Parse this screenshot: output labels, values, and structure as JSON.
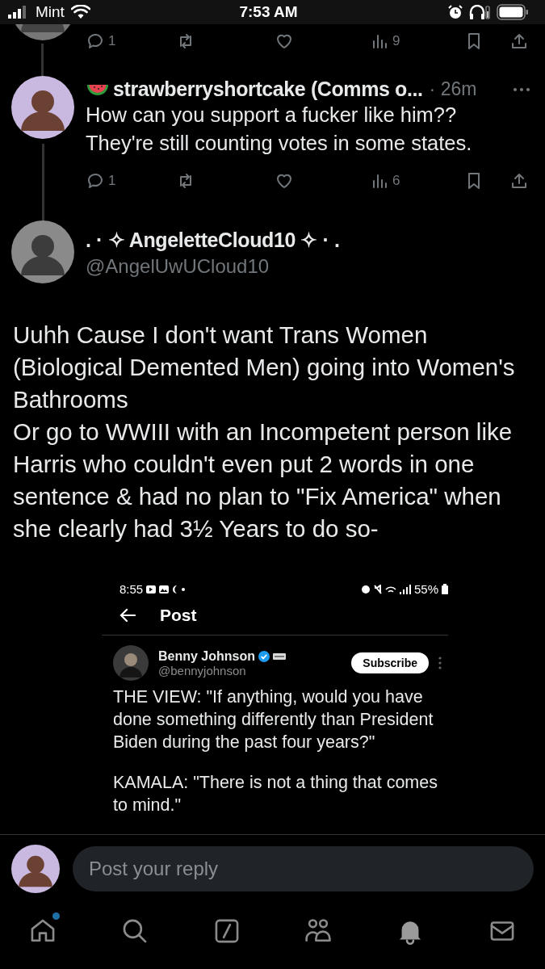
{
  "status_bar": {
    "carrier": "Mint",
    "time": "7:53 AM"
  },
  "previous_post": {
    "actions": {
      "replies": "1",
      "views": "9"
    }
  },
  "reply_post": {
    "name": "strawberryshortcake (Comms o...",
    "time": "· 26m",
    "text": "How can you support a fucker like him??\nThey're still counting votes in some states.",
    "actions": {
      "replies": "1",
      "views": "6"
    }
  },
  "main_post": {
    "name": ". · ✧ AngeletteCloud10 ✧ · .",
    "handle": "@AngelUwUCloud10",
    "text": "Uuhh Cause I don't want Trans Women (Biological Demented Men) going into Women's Bathrooms\nOr go to WWIII with an Incompetent person like Harris who couldn't even put 2 words in one sentence & had no plan to \"Fix America\" when she clearly had 3½ Years to do so-",
    "attached_screenshot": {
      "status_time": "8:55",
      "battery": "55%",
      "header": "Post",
      "author_name": "Benny Johnson",
      "author_handle": "@bennyjohnson",
      "subscribe": "Subscribe",
      "paragraphs": [
        "THE VIEW: \"If anything, would you have done something differently than President Biden during the past four years?\"",
        "KAMALA: \"There is not a thing that comes to mind.\""
      ]
    }
  },
  "reply_box": {
    "placeholder": "Post your reply"
  },
  "nav": [
    {
      "kind": "home",
      "selected": false,
      "badge": true
    },
    {
      "kind": "search",
      "selected": false,
      "badge": false
    },
    {
      "kind": "grok",
      "selected": false,
      "badge": false
    },
    {
      "kind": "communities",
      "selected": false,
      "badge": false
    },
    {
      "kind": "notifications",
      "selected": true,
      "badge": false
    },
    {
      "kind": "messages",
      "selected": false,
      "badge": false
    }
  ]
}
